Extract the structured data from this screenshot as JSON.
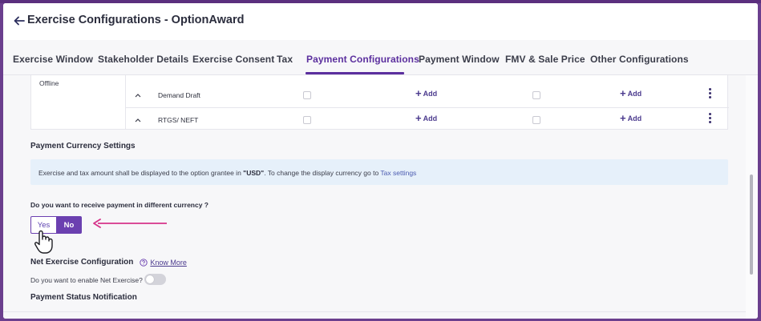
{
  "header": {
    "title": "Exercise Configurations - OptionAward"
  },
  "tabs": [
    {
      "label": "Exercise Window"
    },
    {
      "label": "Stakeholder Details"
    },
    {
      "label": "Exercise Consent"
    },
    {
      "label": "Tax"
    },
    {
      "label": "Payment Configurations",
      "active": true
    },
    {
      "label": "Payment Window"
    },
    {
      "label": "FMV & Sale Price"
    },
    {
      "label": "Other Configurations"
    }
  ],
  "payment_table": {
    "group_label": "Offline",
    "rows": [
      {
        "label": "Demand Draft",
        "add1": "Add",
        "add2": "Add"
      },
      {
        "label": "RTGS/ NEFT",
        "add1": "Add",
        "add2": "Add"
      }
    ]
  },
  "currency": {
    "title": "Payment Currency Settings",
    "info_prefix": "Exercise and tax amount shall be displayed to the option grantee in ",
    "info_currency": "\"USD\"",
    "info_suffix": ". To change the display currency go to ",
    "info_link": "Tax settings",
    "question": "Do you want to receive payment in different currency ?",
    "yes": "Yes",
    "no": "No",
    "selected": "No"
  },
  "net_exercise": {
    "title": "Net Exercise Configuration",
    "know_more": "Know More",
    "question": "Do you want to enable Net Exercise?",
    "enabled": false
  },
  "status": {
    "title": "Payment Status Notification"
  },
  "colors": {
    "accent": "#6b40b0",
    "frame": "#6b3f8e",
    "info_bg": "#e6f0fa",
    "annotation": "#d6338a"
  },
  "icons": [
    "back-arrow-icon",
    "chevron-up-icon",
    "plus-icon",
    "kebab-menu-icon",
    "help-circle-icon",
    "pointer-hand-icon"
  ]
}
